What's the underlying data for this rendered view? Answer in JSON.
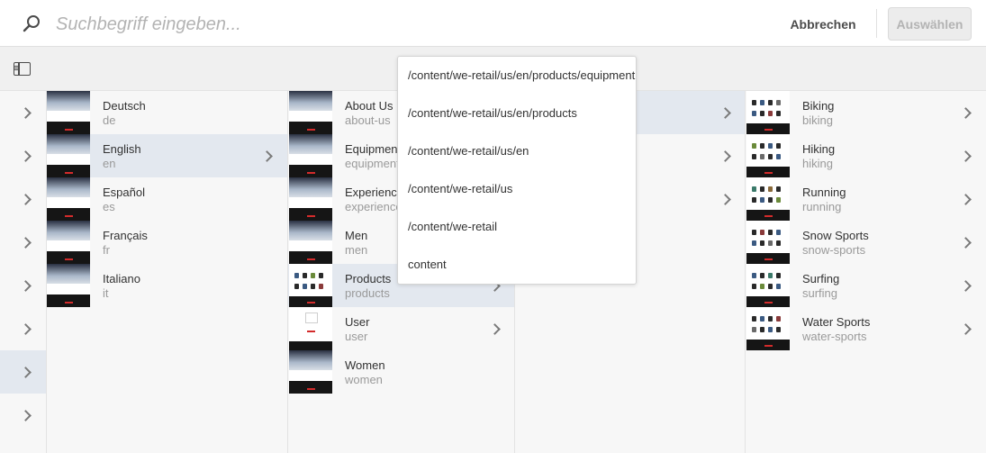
{
  "search": {
    "placeholder": "Suchbegriff eingeben..."
  },
  "header": {
    "cancel_label": "Abbrechen",
    "select_label": "Auswählen"
  },
  "column_languages": {
    "items": [
      {
        "title": "Deutsch",
        "name": "de"
      },
      {
        "title": "English",
        "name": "en"
      },
      {
        "title": "Español",
        "name": "es"
      },
      {
        "title": "Français",
        "name": "fr"
      },
      {
        "title": "Italiano",
        "name": "it"
      }
    ]
  },
  "column_pages": {
    "items": [
      {
        "title": "About Us",
        "name": "about-us"
      },
      {
        "title": "Equipment",
        "name": "equipment"
      },
      {
        "title": "Experience",
        "name": "experience"
      },
      {
        "title": "Men",
        "name": "men"
      },
      {
        "title": "Products",
        "name": "products"
      },
      {
        "title": "User",
        "name": "user"
      },
      {
        "title": "Women",
        "name": "women"
      }
    ]
  },
  "column_equipment": {
    "items": [
      {
        "title": "Biking",
        "name": "biking"
      },
      {
        "title": "Hiking",
        "name": "hiking"
      },
      {
        "title": "Running",
        "name": "running"
      },
      {
        "title": "Snow Sports",
        "name": "snow-sports"
      },
      {
        "title": "Surfing",
        "name": "surfing"
      },
      {
        "title": "Water Sports",
        "name": "water-sports"
      }
    ]
  },
  "path_dropdown": {
    "items": [
      "/content/we-retail/us/en/products/equipment",
      "/content/we-retail/us/en/products",
      "/content/we-retail/us/en",
      "/content/we-retail/us",
      "/content/we-retail",
      "content"
    ]
  },
  "icons": {
    "search": "search-icon",
    "rail_toggle": "rail-toggle-icon",
    "chevron": "chevron-right-icon"
  },
  "colors": {
    "selected_row": "#e3e8ef",
    "primary_disabled": "#ececec"
  }
}
